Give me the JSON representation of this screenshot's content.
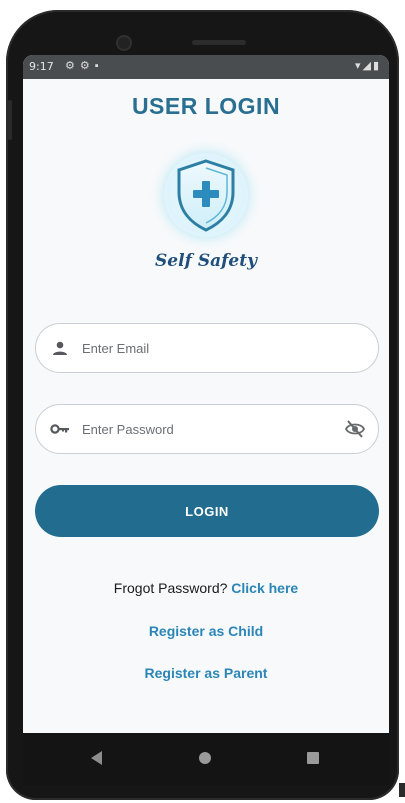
{
  "status_bar": {
    "time": "9:17",
    "left_icons": [
      "settings-icon",
      "settings-icon",
      "sd-card-icon"
    ],
    "right_icons": [
      "wifi-icon",
      "signal-icon",
      "battery-icon"
    ]
  },
  "header": {
    "title": "USER LOGIN"
  },
  "logo": {
    "icon": "shield-plus-icon",
    "brand_text": "Self Safety"
  },
  "form": {
    "email": {
      "placeholder": "Enter Email",
      "value": "",
      "icon": "person-icon"
    },
    "password": {
      "placeholder": "Enter Password",
      "value": "",
      "icon": "key-icon",
      "toggle_icon": "eye-off-icon"
    },
    "login_label": "LOGIN"
  },
  "links": {
    "forgot_text": "Frogot Password?",
    "forgot_link": "Click here",
    "register_child": "Register as Child",
    "register_parent": "Register as Parent"
  },
  "nav_bar": {
    "icons": [
      "back-icon",
      "home-icon",
      "recents-icon"
    ]
  },
  "colors": {
    "primary": "#226d8f",
    "title": "#2a6f92",
    "link": "#2b86b7",
    "status_bar": "#4a4d50"
  }
}
